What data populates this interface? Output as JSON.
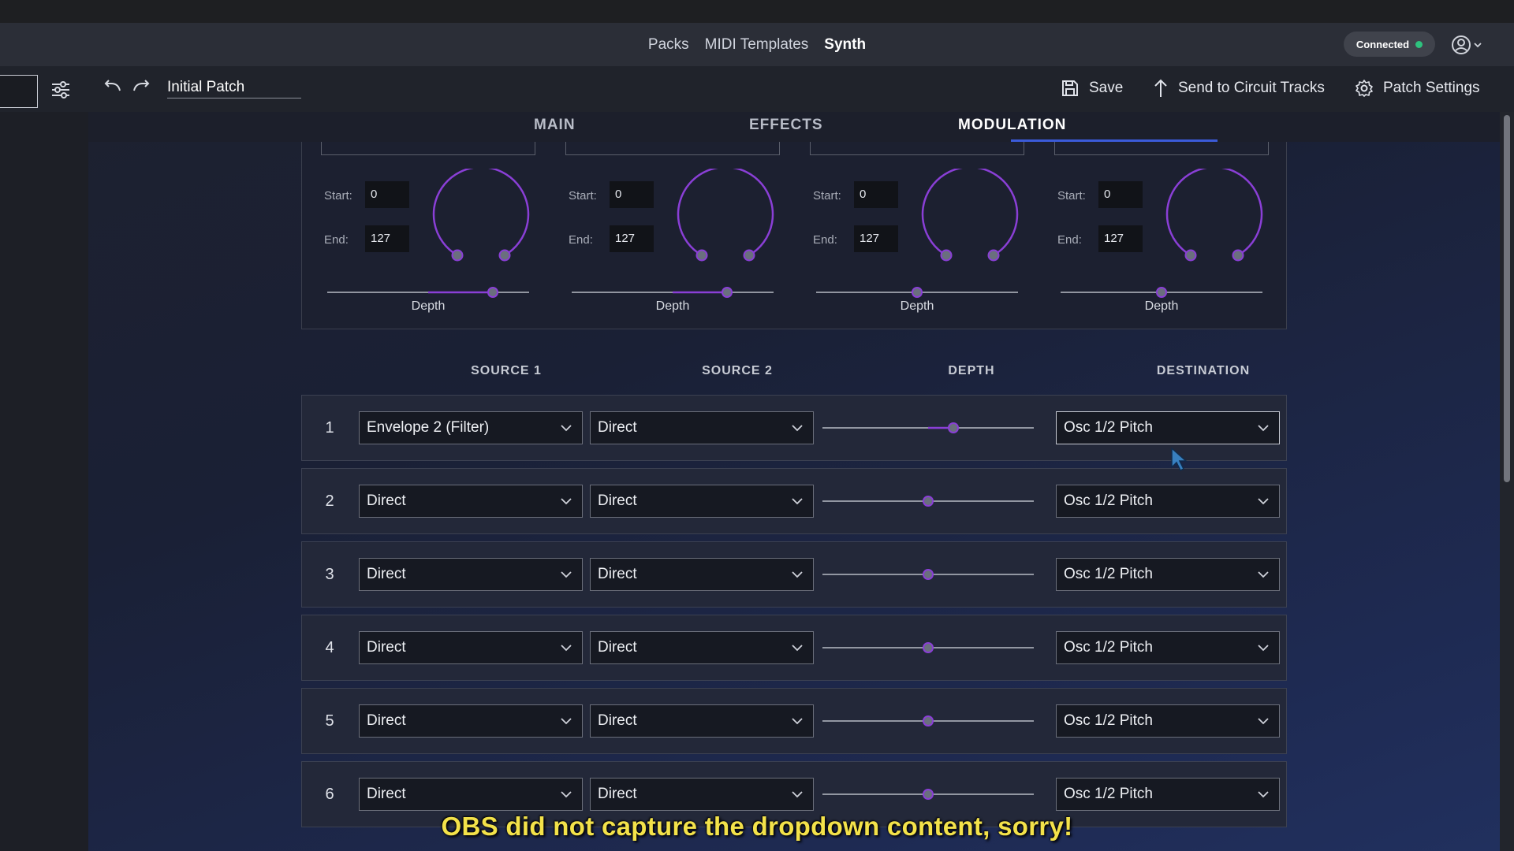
{
  "nav": {
    "links": [
      "Packs",
      "MIDI Templates",
      "Synth"
    ],
    "active": "Synth",
    "connection": "Connected",
    "connection_color": "#2ec27e"
  },
  "toolbar": {
    "patch_name": "Initial Patch",
    "save_label": "Save",
    "send_label": "Send to Circuit Tracks",
    "settings_label": "Patch Settings"
  },
  "tabs": [
    "MAIN",
    "EFFECTS",
    "MODULATION"
  ],
  "active_tab": "MODULATION",
  "macros": [
    {
      "start_label": "Start:",
      "start": "0",
      "end_label": "End:",
      "end": "127",
      "depth_label": "Depth",
      "depth": 0.82
    },
    {
      "start_label": "Start:",
      "start": "0",
      "end_label": "End:",
      "end": "127",
      "depth_label": "Depth",
      "depth": 0.77
    },
    {
      "start_label": "Start:",
      "start": "0",
      "end_label": "End:",
      "end": "127",
      "depth_label": "Depth",
      "depth": 0.5
    },
    {
      "start_label": "Start:",
      "start": "0",
      "end_label": "End:",
      "end": "127",
      "depth_label": "Depth",
      "depth": 0.5
    }
  ],
  "matrix": {
    "headers": [
      "SOURCE 1",
      "SOURCE 2",
      "DEPTH",
      "DESTINATION"
    ],
    "rows": [
      {
        "num": "1",
        "source1": "Envelope 2 (Filter)",
        "source2": "Direct",
        "depth": 0.62,
        "destination": "Osc 1/2 Pitch"
      },
      {
        "num": "2",
        "source1": "Direct",
        "source2": "Direct",
        "depth": 0.5,
        "destination": "Osc 1/2 Pitch"
      },
      {
        "num": "3",
        "source1": "Direct",
        "source2": "Direct",
        "depth": 0.5,
        "destination": "Osc 1/2 Pitch"
      },
      {
        "num": "4",
        "source1": "Direct",
        "source2": "Direct",
        "depth": 0.5,
        "destination": "Osc 1/2 Pitch"
      },
      {
        "num": "5",
        "source1": "Direct",
        "source2": "Direct",
        "depth": 0.5,
        "destination": "Osc 1/2 Pitch"
      },
      {
        "num": "6",
        "source1": "Direct",
        "source2": "Direct",
        "depth": 0.5,
        "destination": "Osc 1/2 Pitch"
      }
    ]
  },
  "overlay_caption": "OBS did not capture the dropdown content, sorry!",
  "colors": {
    "accent_purple": "#8a3fd6",
    "tab_underline": "#3b5bd9"
  }
}
